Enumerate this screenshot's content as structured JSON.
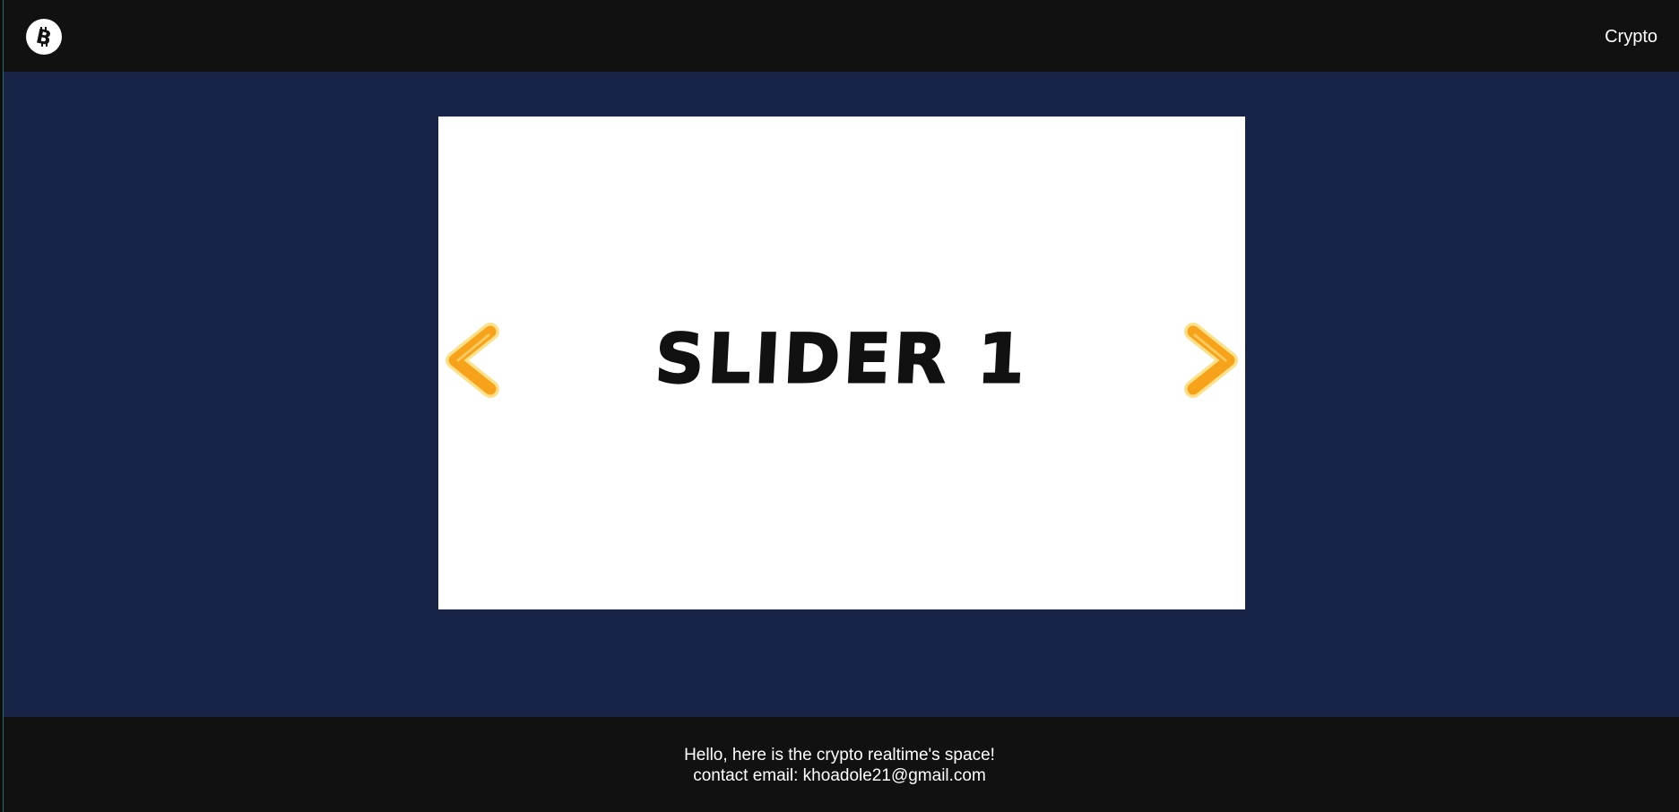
{
  "header": {
    "logo_icon": "bitcoin-icon",
    "nav_link_label": "Crypto"
  },
  "slider": {
    "slide_text": "SLIDER 1",
    "prev_icon": "chevron-left-icon",
    "next_icon": "chevron-right-icon",
    "arrow_color": "#f7a21b"
  },
  "footer": {
    "line1": "Hello, here is the crypto realtime's space!",
    "line2": "contact email: khoadole21@gmail.com"
  },
  "colors": {
    "header_bg": "#111111",
    "main_bg": "#172448",
    "slide_bg": "#ffffff",
    "footer_bg": "#111111"
  }
}
